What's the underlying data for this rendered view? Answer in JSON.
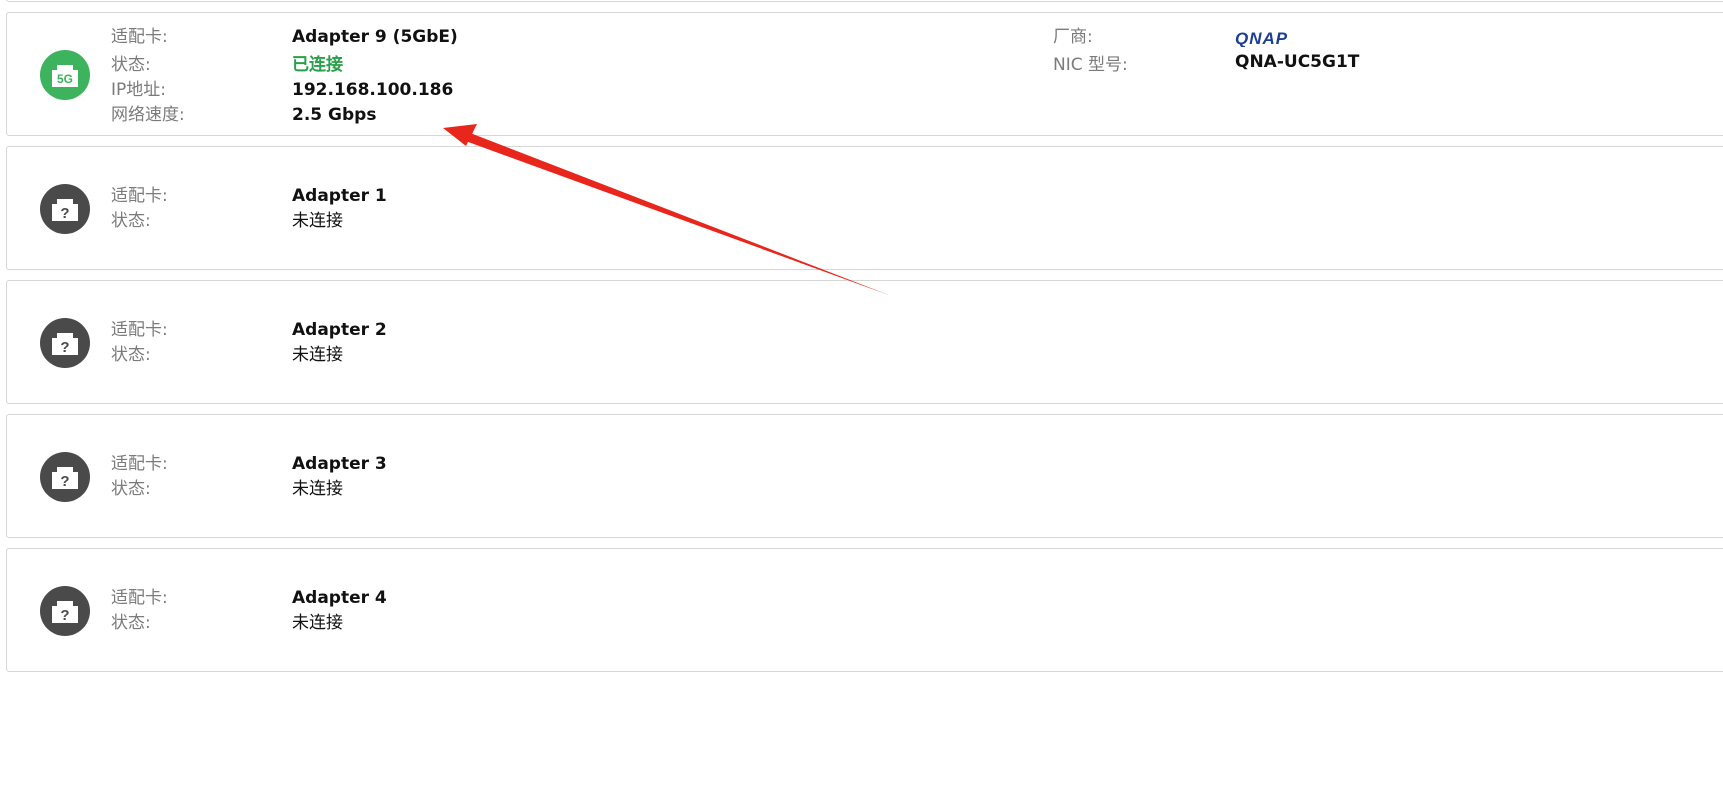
{
  "labels": {
    "adapter": "适配卡:",
    "status": "状态:",
    "ip": "IP地址:",
    "speed": "网络速度:",
    "vendor": "厂商:",
    "nic_model": "NIC 型号:"
  },
  "adapters": [
    {
      "icon": "5g-ethernet-icon",
      "icon_text": "5G",
      "icon_color": "#3cb35c",
      "name": "Adapter 9 (5GbE)",
      "status": "已连接",
      "status_color": "#27a049",
      "ip": "192.168.100.186",
      "speed": "2.5 Gbps",
      "vendor_logo_text": "QNAP",
      "vendor_logo_color": "#1c3f94",
      "nic_model": "QNA-UC5G1T"
    },
    {
      "icon": "unknown-ethernet-icon",
      "icon_color": "#4a4a4a",
      "name": "Adapter 1",
      "status": "未连接"
    },
    {
      "icon": "unknown-ethernet-icon",
      "icon_color": "#4a4a4a",
      "name": "Adapter 2",
      "status": "未连接"
    },
    {
      "icon": "unknown-ethernet-icon",
      "icon_color": "#4a4a4a",
      "name": "Adapter 3",
      "status": "未连接"
    },
    {
      "icon": "unknown-ethernet-icon",
      "icon_color": "#4a4a4a",
      "name": "Adapter 4",
      "status": "未连接"
    }
  ],
  "annotation": {
    "arrow_color": "#e8261c"
  }
}
